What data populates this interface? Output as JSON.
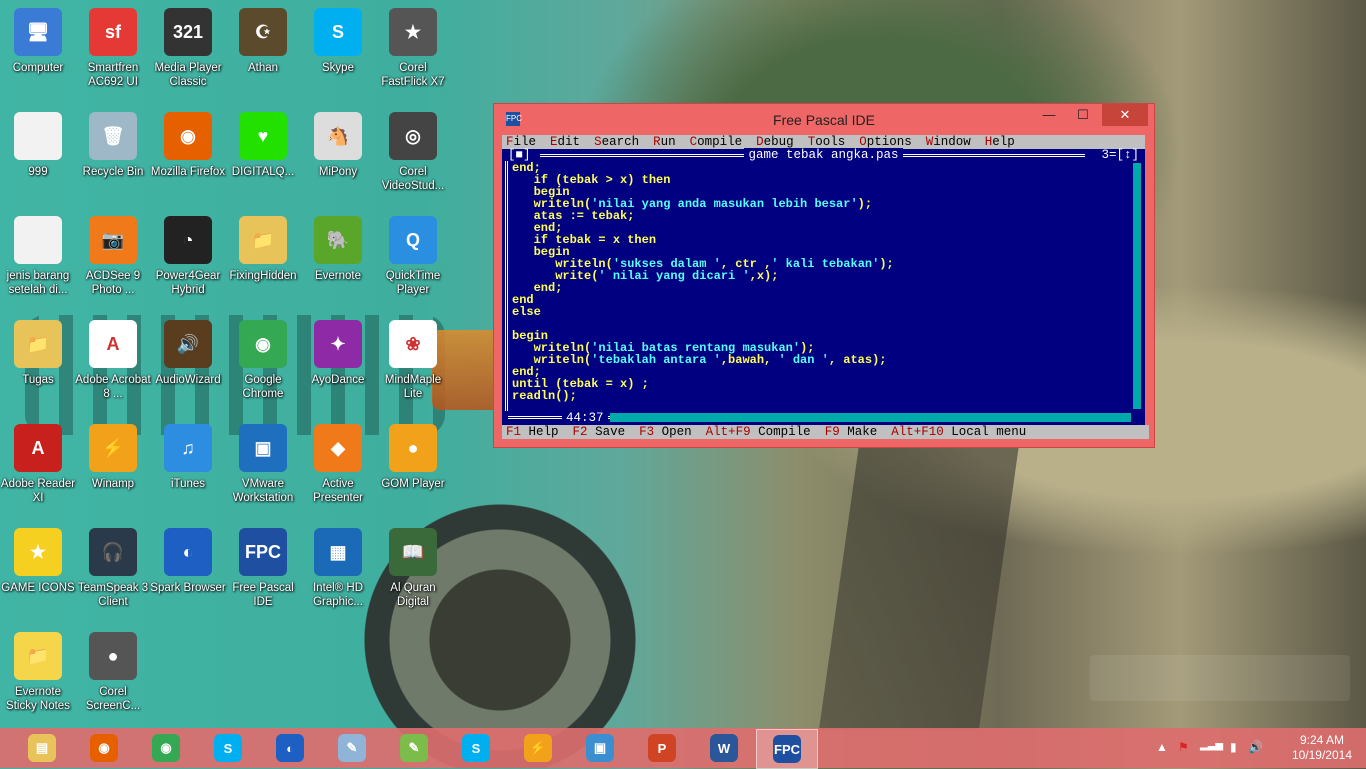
{
  "desktop": {
    "icons": [
      {
        "label": "Computer",
        "icon": "computer-icon",
        "color": "#3a7bd5",
        "glyph": "🖥"
      },
      {
        "label": "Smartfren AC692 UI",
        "icon": "smartfren-icon",
        "color": "#e53935",
        "glyph": "sf"
      },
      {
        "label": "Media Player Classic",
        "icon": "media-player-icon",
        "color": "#333333",
        "glyph": "321"
      },
      {
        "label": "Athan",
        "icon": "athan-icon",
        "color": "#5b4a2b",
        "glyph": "☪"
      },
      {
        "label": "Skype",
        "icon": "skype-icon",
        "color": "#00aff0",
        "glyph": "S"
      },
      {
        "label": "Corel FastFlick X7",
        "icon": "corel-fastflick-icon",
        "color": "#555555",
        "glyph": "★"
      },
      {
        "label": "999",
        "icon": "document-icon",
        "color": "#f2f2f2",
        "glyph": ""
      },
      {
        "label": "Recycle Bin",
        "icon": "recycle-bin-icon",
        "color": "#9fb8c8",
        "glyph": "🗑"
      },
      {
        "label": "Mozilla Firefox",
        "icon": "firefox-icon",
        "color": "#e66000",
        "glyph": "◉"
      },
      {
        "label": "DIGITALQ...",
        "icon": "heart-icon",
        "color": "#22e000",
        "glyph": "♥"
      },
      {
        "label": "MiPony",
        "icon": "mipony-icon",
        "color": "#dddddd",
        "glyph": "🐴"
      },
      {
        "label": "Corel VideoStud...",
        "icon": "corel-videostudio-icon",
        "color": "#444444",
        "glyph": "◎"
      },
      {
        "label": "jenis barang setelah di...",
        "icon": "document-icon",
        "color": "#f2f2f2",
        "glyph": ""
      },
      {
        "label": "ACDSee 9 Photo ...",
        "icon": "acdsee-icon",
        "color": "#f07a1a",
        "glyph": "📷"
      },
      {
        "label": "Power4Gear Hybrid",
        "icon": "power4gear-icon",
        "color": "#222222",
        "glyph": "◔"
      },
      {
        "label": "FixingHidden",
        "icon": "folder-icon",
        "color": "#e8c35a",
        "glyph": "📁"
      },
      {
        "label": "Evernote",
        "icon": "evernote-icon",
        "color": "#5aa62b",
        "glyph": "🐘"
      },
      {
        "label": "QuickTime Player",
        "icon": "quicktime-icon",
        "color": "#2a8fe0",
        "glyph": "Q"
      },
      {
        "label": "Tugas",
        "icon": "folder-icon",
        "color": "#e8c35a",
        "glyph": "📁"
      },
      {
        "label": "Adobe Acrobat 8 ...",
        "icon": "acrobat-icon",
        "color": "#ffffff",
        "glyph": "A"
      },
      {
        "label": "AudioWizard",
        "icon": "audiowizard-icon",
        "color": "#5a3c1e",
        "glyph": "🔊"
      },
      {
        "label": "Google Chrome",
        "icon": "chrome-icon",
        "color": "#34a853",
        "glyph": "◉"
      },
      {
        "label": "AyoDance",
        "icon": "ayodance-icon",
        "color": "#8e2aa6",
        "glyph": "✦"
      },
      {
        "label": "MindMaple Lite",
        "icon": "mindmaple-icon",
        "color": "#ffffff",
        "glyph": "❀"
      },
      {
        "label": "Adobe Reader XI",
        "icon": "adobe-reader-icon",
        "color": "#c8201c",
        "glyph": "A"
      },
      {
        "label": "Winamp",
        "icon": "winamp-icon",
        "color": "#f2a21a",
        "glyph": "⚡"
      },
      {
        "label": "iTunes",
        "icon": "itunes-icon",
        "color": "#2d8de0",
        "glyph": "♫"
      },
      {
        "label": "VMware Workstation",
        "icon": "vmware-icon",
        "color": "#1f6fbf",
        "glyph": "▣"
      },
      {
        "label": "Active Presenter",
        "icon": "active-presenter-icon",
        "color": "#f07a1a",
        "glyph": "◆"
      },
      {
        "label": "GOM Player",
        "icon": "gom-player-icon",
        "color": "#f2a21a",
        "glyph": "●"
      },
      {
        "label": "GAME ICONS",
        "icon": "star-icon",
        "color": "#f5d020",
        "glyph": "★"
      },
      {
        "label": "TeamSpeak 3 Client",
        "icon": "teamspeak-icon",
        "color": "#2a3a4a",
        "glyph": "🎧"
      },
      {
        "label": "Spark Browser",
        "icon": "spark-browser-icon",
        "color": "#1d5fc2",
        "glyph": "◐"
      },
      {
        "label": "Free Pascal IDE",
        "icon": "free-pascal-icon",
        "color": "#1e4fa0",
        "glyph": "FPC"
      },
      {
        "label": "Intel® HD Graphic...",
        "icon": "intel-graphics-icon",
        "color": "#1a6ab8",
        "glyph": "▦"
      },
      {
        "label": "Al Quran Digital",
        "icon": "al-quran-icon",
        "color": "#3a6a3a",
        "glyph": "📖"
      },
      {
        "label": "Evernote Sticky Notes",
        "icon": "sticky-notes-icon",
        "color": "#f5d64a",
        "glyph": "📁"
      },
      {
        "label": "Corel ScreenC...",
        "icon": "corel-screencap-icon",
        "color": "#555555",
        "glyph": "●"
      }
    ]
  },
  "ide": {
    "window_title": "Free Pascal IDE",
    "app_icon": "FPC",
    "minimize": "—",
    "maximize": "☐",
    "close": "✕",
    "menu": [
      {
        "hot": "F",
        "rest": "ile"
      },
      {
        "hot": "E",
        "rest": "dit"
      },
      {
        "hot": "S",
        "rest": "earch"
      },
      {
        "hot": "R",
        "rest": "un"
      },
      {
        "hot": "C",
        "rest": "ompile"
      },
      {
        "hot": "D",
        "rest": "ebug"
      },
      {
        "hot": "T",
        "rest": "ools"
      },
      {
        "hot": "O",
        "rest": "ptions"
      },
      {
        "hot": "W",
        "rest": "indow"
      },
      {
        "hot": "H",
        "rest": "elp"
      }
    ],
    "editor": {
      "filename": "game tebak angka.pas",
      "frame_left": "[■]",
      "frame_right": "3=[↕]",
      "cursor_position": "44:37",
      "code_lines": [
        "end;",
        "   if (tebak > x) then",
        "   begin",
        "   writeln('nilai yang anda masukan lebih besar');",
        "   atas := tebak;",
        "   end;",
        "   if tebak = x then",
        "   begin",
        "      writeln('sukses dalam ', ctr ,' kali tebakan');",
        "      write(' nilai yang dicari ',x);",
        "   end;",
        "end",
        "else",
        "",
        "begin",
        "   writeln('nilai batas rentang masukan');",
        "   writeln('tebaklah antara ',bawah, ' dan ', atas);",
        "end;",
        "until (tebak = x) ;",
        "readln();"
      ]
    },
    "status": [
      {
        "key": "F1",
        "label": "Help"
      },
      {
        "key": "F2",
        "label": "Save"
      },
      {
        "key": "F3",
        "label": "Open"
      },
      {
        "key": "Alt+F9",
        "label": "Compile"
      },
      {
        "key": "F9",
        "label": "Make"
      },
      {
        "key": "Alt+F10",
        "label": "Local menu"
      }
    ]
  },
  "taskbar": {
    "items": [
      {
        "name": "file-explorer",
        "icon": "folder-icon",
        "color": "#e8c35a",
        "glyph": "▤",
        "active": false
      },
      {
        "name": "firefox",
        "icon": "firefox-icon",
        "color": "#e66000",
        "glyph": "◉",
        "active": false
      },
      {
        "name": "chrome",
        "icon": "chrome-icon",
        "color": "#34a853",
        "glyph": "◉",
        "active": false
      },
      {
        "name": "skype",
        "icon": "skype-icon",
        "color": "#00aff0",
        "glyph": "S",
        "active": false
      },
      {
        "name": "spark-browser",
        "icon": "spark-browser-icon",
        "color": "#1d5fc2",
        "glyph": "◐",
        "active": false
      },
      {
        "name": "notepad",
        "icon": "notepad-icon",
        "color": "#8fb4d8",
        "glyph": "✎",
        "active": false
      },
      {
        "name": "notepad-plus",
        "icon": "notepad-plus-icon",
        "color": "#7cbc4a",
        "glyph": "✎",
        "active": false
      },
      {
        "name": "skype-2",
        "icon": "skype-icon",
        "color": "#00aff0",
        "glyph": "S",
        "active": false
      },
      {
        "name": "winamp",
        "icon": "winamp-icon",
        "color": "#f2a21a",
        "glyph": "⚡",
        "active": false
      },
      {
        "name": "photos",
        "icon": "photo-viewer-icon",
        "color": "#3b8ed0",
        "glyph": "▣",
        "active": false
      },
      {
        "name": "powerpoint",
        "icon": "powerpoint-icon",
        "color": "#d04423",
        "glyph": "P",
        "active": false
      },
      {
        "name": "word",
        "icon": "word-icon",
        "color": "#2b579a",
        "glyph": "W",
        "active": false
      },
      {
        "name": "free-pascal",
        "icon": "free-pascal-icon",
        "color": "#1e4fa0",
        "glyph": "FPC",
        "active": true
      }
    ],
    "tray": {
      "show_hidden": "▲",
      "flag": "⚑",
      "signal": "▂▃▅",
      "battery": "▮",
      "volume": "🔊"
    },
    "clock_time": "9:24 AM",
    "clock_date": "10/19/2014"
  }
}
